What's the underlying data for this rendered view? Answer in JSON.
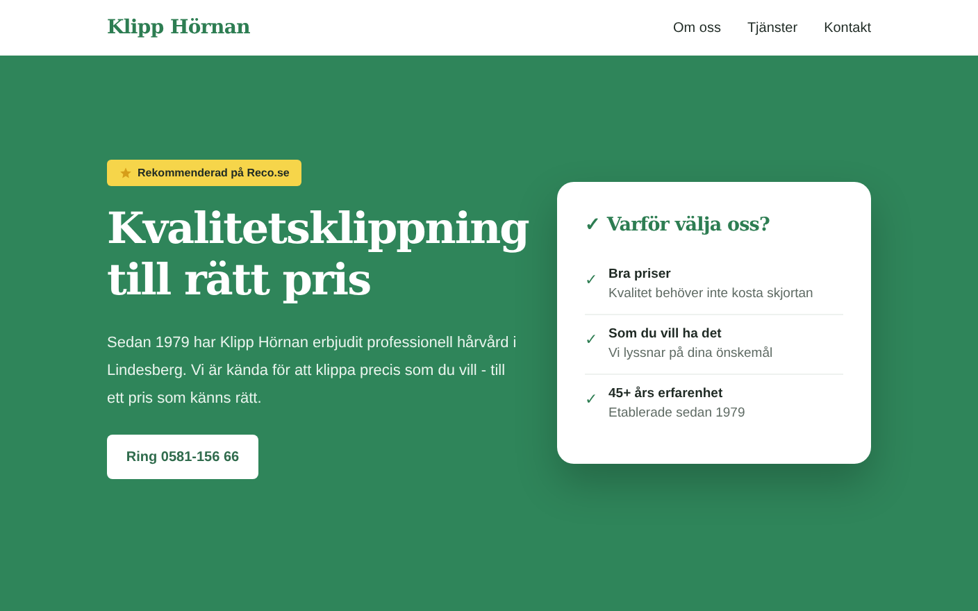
{
  "header": {
    "logo": "Klipp Hörnan",
    "nav": [
      "Om oss",
      "Tjänster",
      "Kontakt"
    ]
  },
  "hero": {
    "badge": {
      "label": "Rekommenderad på Reco.se"
    },
    "title_lines": [
      "Kvalitetsklippning",
      "till rätt pris"
    ],
    "text": "Sedan 1979 har Klipp Hörnan erbjudit professionell hårvård i Lindesberg. Vi är kända för att klippa precis som du vill - till ett pris som känns rätt.",
    "button": "Ring 0581-156 66"
  },
  "card": {
    "title": "✓ Varför välja oss?",
    "items": [
      {
        "check": "✓",
        "title": "Bra priser",
        "text": "Kvalitet behöver inte kosta skjortan"
      },
      {
        "check": "✓",
        "title": "Som du vill ha det",
        "text": "Vi lyssnar på dina önskemål"
      },
      {
        "check": "✓",
        "title": "45+ års erfarenhet",
        "text": "Etablerade sedan 1979"
      }
    ]
  }
}
